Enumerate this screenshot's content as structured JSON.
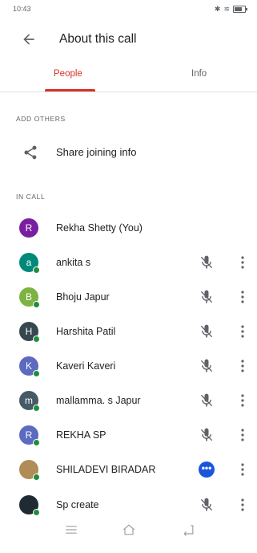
{
  "status_bar": {
    "time": "10:43"
  },
  "header": {
    "title": "About this call"
  },
  "tabs": [
    {
      "label": "People",
      "active": true
    },
    {
      "label": "Info",
      "active": false
    }
  ],
  "sections": {
    "add_others": "ADD OTHERS",
    "in_call": "IN CALL"
  },
  "share": {
    "label": "Share joining info"
  },
  "people": [
    {
      "name": "Rekha Shetty (You)",
      "initial": "R",
      "avatar_color": "#7b1fa2",
      "status": "self"
    },
    {
      "name": "ankita s",
      "initial": "a",
      "avatar_color": "#00897b",
      "status": "muted"
    },
    {
      "name": "Bhoju Japur",
      "initial": "B",
      "avatar_color": "#7cb342",
      "status": "muted"
    },
    {
      "name": "Harshita Patil",
      "initial": "H",
      "avatar_color": "#37474f",
      "status": "muted"
    },
    {
      "name": "Kaveri Kaveri",
      "initial": "K",
      "avatar_color": "#5c6bc0",
      "status": "muted"
    },
    {
      "name": "mallamma. s Japur",
      "initial": "m",
      "avatar_color": "#455a64",
      "status": "muted"
    },
    {
      "name": "REKHA SP",
      "initial": "R",
      "avatar_color": "#5c6bc0",
      "status": "muted"
    },
    {
      "name": "SHILADEVI BIRADAR",
      "initial": "",
      "avatar_color": "#b08d57",
      "status": "presenting"
    },
    {
      "name": "Sp create",
      "initial": "",
      "avatar_color": "#1f2a33",
      "status": "muted"
    }
  ],
  "icons": {
    "back": "arrow-back-icon",
    "share": "share-icon",
    "mic_off": "mic-off-icon",
    "more": "more-vert-icon",
    "presenting": "more-horiz-circle-icon",
    "nav_menu": "menu-icon",
    "nav_home": "home-icon",
    "nav_back": "back-nav-icon"
  },
  "colors": {
    "accent": "#d93025",
    "online": "#1e8e3e",
    "presenting": "#1a56db"
  }
}
